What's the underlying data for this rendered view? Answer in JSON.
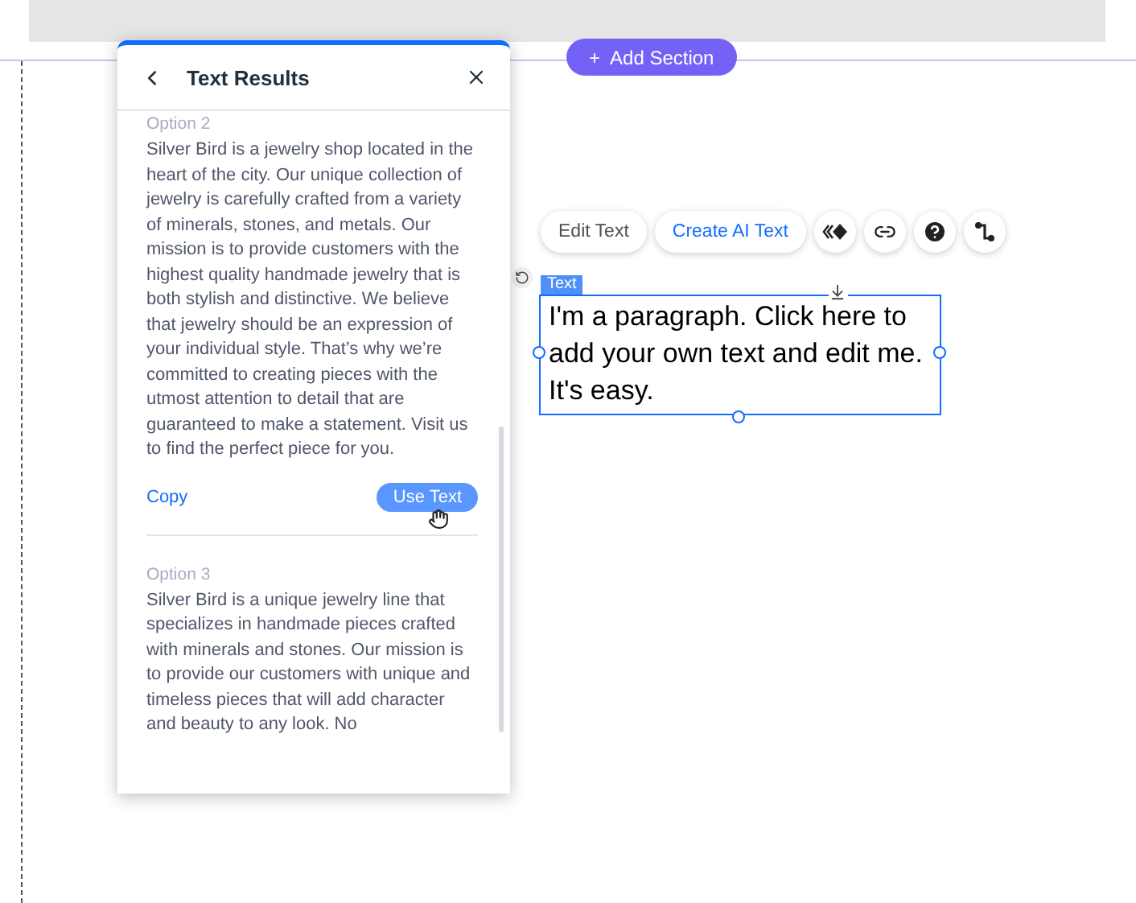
{
  "add_section": {
    "label": "Add Section",
    "icon": "+"
  },
  "panel": {
    "title": "Text Results",
    "options": [
      {
        "label": "Option 2",
        "text": "Silver Bird is a jewelry shop located in the heart of the city. Our unique collection of jewelry is carefully crafted from a variety of minerals, stones, and metals. Our mission is to provide customers with the highest quality handmade jewelry that is both stylish and distinctive. We believe that jewelry should be an expression of your individual style. That’s why we’re committed to creating pieces with the utmost attention to detail that are guaranteed to make a statement. Visit us to find the perfect piece for you.",
        "actions": {
          "copy": "Copy",
          "use": "Use Text"
        }
      },
      {
        "label": "Option 3",
        "text": "Silver Bird is a unique jewelry line that specializes in handmade pieces crafted with minerals and stones. Our mission is to provide our customers with unique and timeless pieces that will add character and beauty to any look. No"
      }
    ]
  },
  "toolbar": {
    "buttons": [
      {
        "label": "Edit Text",
        "kind": "plain"
      },
      {
        "label": "Create AI Text",
        "kind": "accent"
      }
    ]
  },
  "element": {
    "tag": "Text",
    "paragraph": "I'm a paragraph. Click here to add your own text and edit me. It's easy."
  }
}
